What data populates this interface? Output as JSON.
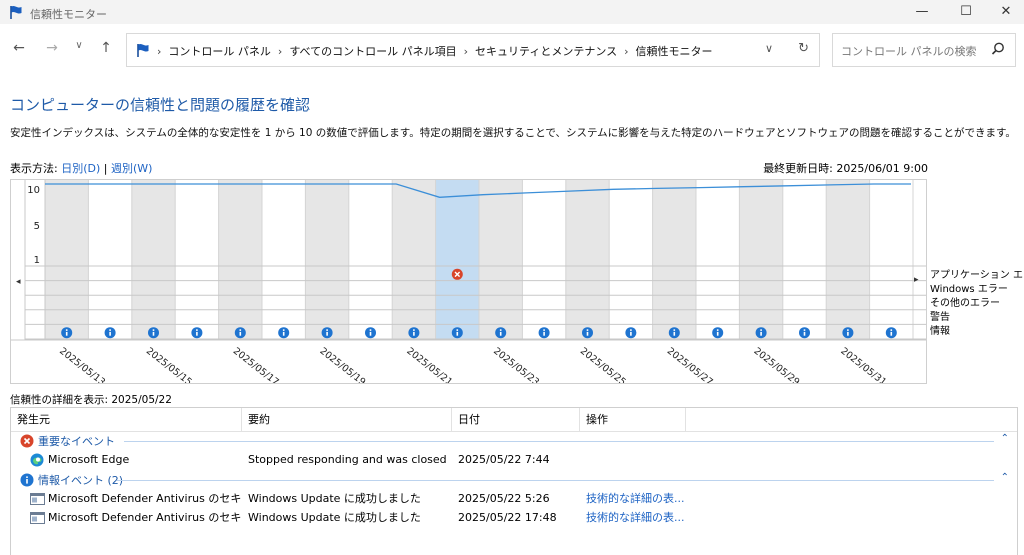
{
  "window": {
    "title": "信頼性モニター"
  },
  "address": {
    "crumbs": [
      "コントロール パネル",
      "すべてのコントロール パネル項目",
      "セキュリティとメンテナンス",
      "信頼性モニター"
    ]
  },
  "search": {
    "placeholder": "コントロール パネルの検索"
  },
  "page": {
    "title": "コンピューターの信頼性と問題の履歴を確認",
    "description": "安定性インデックスは、システムの全体的な安定性を 1 から 10 の数値で評価します。特定の期間を選択することで、システムに影響を与えた特定のハードウェアとソフトウェアの問題を確認することができます。",
    "view_by_label": "表示方法: ",
    "view_daily": "日別(D)",
    "view_sep": "|",
    "view_weekly": "週別(W)",
    "last_updated": "最終更新日時: 2025/06/01 9:00"
  },
  "chart_data": {
    "type": "line",
    "y_ticks": [
      "10",
      "5",
      "1"
    ],
    "ylim": [
      1,
      10
    ],
    "dates": [
      "2025/05/13",
      "2025/05/14",
      "2025/05/15",
      "2025/05/16",
      "2025/05/17",
      "2025/05/18",
      "2025/05/19",
      "2025/05/20",
      "2025/05/21",
      "2025/05/22",
      "2025/05/23",
      "2025/05/24",
      "2025/05/25",
      "2025/05/26",
      "2025/05/27",
      "2025/05/28",
      "2025/05/29",
      "2025/05/30",
      "2025/05/31",
      "2025/06/01"
    ],
    "x_tick_labels": [
      "2025/05/13",
      "2025/05/15",
      "2025/05/17",
      "2025/05/19",
      "2025/05/21",
      "2025/05/23",
      "2025/05/25",
      "2025/05/27",
      "2025/05/29",
      "2025/05/31"
    ],
    "stability": [
      10,
      10,
      10,
      10,
      10,
      10,
      10,
      10,
      10,
      8.5,
      8.8,
      9.0,
      9.2,
      9.4,
      9.5,
      9.6,
      9.7,
      9.8,
      9.9,
      10
    ],
    "selected_date": "2025/05/22",
    "rows": [
      "アプリケーション エラー",
      "Windows エラー",
      "その他のエラー",
      "警告",
      "情報"
    ],
    "app_error_dates": [
      "2025/05/22"
    ],
    "info_dates": [
      "2025/05/13",
      "2025/05/14",
      "2025/05/15",
      "2025/05/16",
      "2025/05/17",
      "2025/05/18",
      "2025/05/19",
      "2025/05/20",
      "2025/05/21",
      "2025/05/22",
      "2025/05/23",
      "2025/05/24",
      "2025/05/25",
      "2025/05/26",
      "2025/05/27",
      "2025/05/28",
      "2025/05/29",
      "2025/05/30",
      "2025/05/31",
      "2025/06/01"
    ]
  },
  "details": {
    "label": "信頼性の詳細を表示: 2025/05/22",
    "columns": [
      "発生元",
      "要約",
      "日付",
      "操作"
    ],
    "critical_group": "重要なイベント",
    "critical_rows": [
      {
        "source": "Microsoft Edge",
        "summary": "Stopped responding and was closed",
        "date": "2025/05/22 7:44",
        "action": ""
      }
    ],
    "info_group": "情報イベント (2)",
    "info_rows": [
      {
        "source": "Microsoft Defender Antivirus のセキュリ...",
        "summary": "Windows Update に成功しました",
        "date": "2025/05/22 5:26",
        "action": "技術的な詳細の表..."
      },
      {
        "source": "Microsoft Defender Antivirus のセキュリ...",
        "summary": "Windows Update に成功しました",
        "date": "2025/05/22 17:48",
        "action": "技術的な詳細の表..."
      }
    ]
  },
  "colors": {
    "accent": "#1e5aa8",
    "selected_column": "#c4dcf2",
    "line": "#3c8fd8",
    "error": "#d8452b",
    "info": "#1f74d0"
  }
}
